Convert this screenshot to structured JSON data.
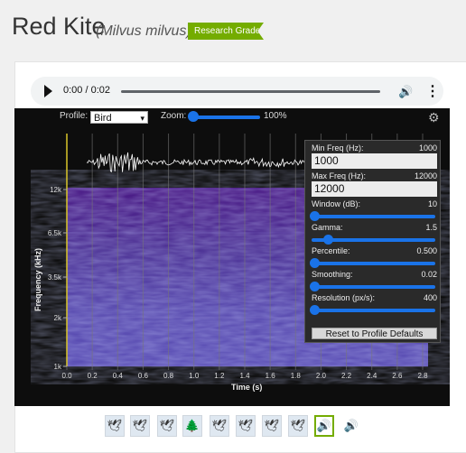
{
  "header": {
    "title": "Red Kite",
    "scientific_name": "(Milvus milvus)",
    "grade_badge": "Research Grade"
  },
  "audio": {
    "time": "0:00 / 0:02",
    "play_icon": "play-icon",
    "volume_icon": "volume-icon",
    "more_icon": "more-vert-icon"
  },
  "spectrogram": {
    "profile_label": "Profile:",
    "profile_value": "Bird",
    "zoom_label": "Zoom:",
    "zoom_value": "100%",
    "y_axis_label": "Frequency (kHz)",
    "x_axis_label": "Time (s)",
    "y_ticks": [
      "12k",
      "6.5k",
      "3.5k",
      "2k",
      "1k"
    ],
    "x_ticks": [
      "0.0",
      "0.2",
      "0.4",
      "0.6",
      "0.8",
      "1.0",
      "1.2",
      "1.4",
      "1.6",
      "1.8",
      "2.0",
      "2.2",
      "2.4",
      "2.6",
      "2.8"
    ]
  },
  "settings": {
    "min_freq_label": "Min Freq (Hz):",
    "min_freq_value": "1000",
    "min_freq_input": "1000",
    "max_freq_label": "Max Freq (Hz):",
    "max_freq_value": "12000",
    "max_freq_input": "12000",
    "window_label": "Window (dB):",
    "window_value": "10",
    "window_level": 0.0,
    "gamma_label": "Gamma:",
    "gamma_value": "1.5",
    "gamma_level": 0.12,
    "percentile_label": "Percentile:",
    "percentile_value": "0.500",
    "percentile_level": 0.0,
    "smoothing_label": "Smoothing:",
    "smoothing_value": "0.02",
    "smoothing_level": 0.0,
    "resolution_label": "Resolution (px/s):",
    "resolution_value": "400",
    "resolution_level": 0.0,
    "reset_label": "Reset to Profile Defaults"
  },
  "thumbnails": [
    {
      "icon": "bird-flight-icon"
    },
    {
      "icon": "bird-flight-icon"
    },
    {
      "icon": "bird-flight-icon"
    },
    {
      "icon": "trees-icon"
    },
    {
      "icon": "bird-flight-icon"
    },
    {
      "icon": "bird-flight-icon"
    },
    {
      "icon": "bird-flight-icon"
    },
    {
      "icon": "bird-flight-icon"
    },
    {
      "icon": "sound-icon"
    },
    {
      "icon": "sound-icon"
    }
  ],
  "colors": {
    "badge": "#74ac00",
    "accent": "#1a73e8",
    "spectrogram_bg": "#4a2a9a"
  }
}
